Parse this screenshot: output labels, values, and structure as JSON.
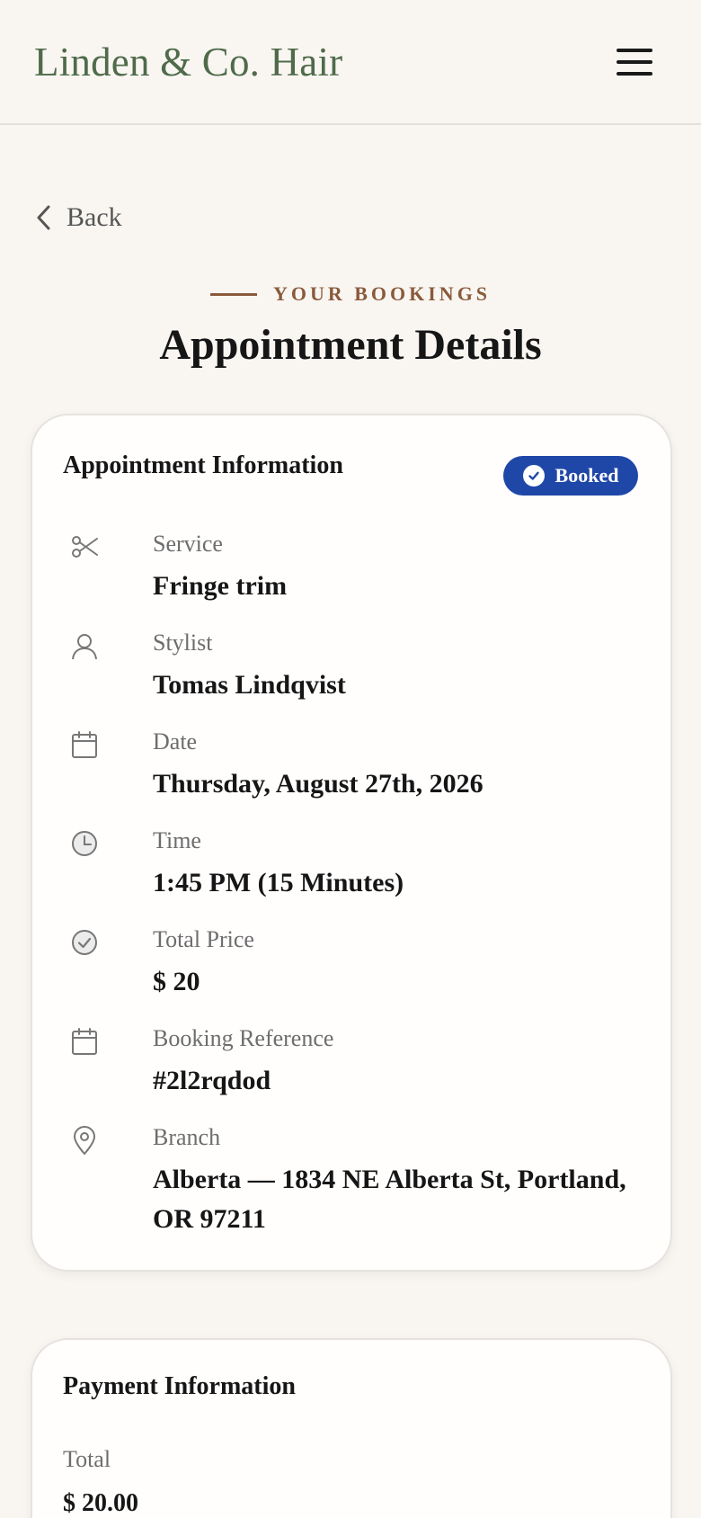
{
  "header": {
    "brand": "Linden & Co. Hair",
    "menu_icon": "hamburger-menu-icon"
  },
  "nav": {
    "back_label": "Back",
    "back_icon": "chevron-left-icon"
  },
  "page": {
    "eyebrow": "YOUR BOOKINGS",
    "title": "Appointment Details"
  },
  "appointment": {
    "title": "Appointment Information",
    "status": "Booked",
    "status_color": "#1f47a8",
    "fields": [
      {
        "icon": "scissors-icon",
        "label": "Service",
        "value": "Fringe trim"
      },
      {
        "icon": "user-icon",
        "label": "Stylist",
        "value": "Tomas Lindqvist"
      },
      {
        "icon": "calendar-icon",
        "label": "Date",
        "value": "Thursday, August 27th, 2026"
      },
      {
        "icon": "clock-icon",
        "label": "Time",
        "value": "1:45 PM (15 Minutes)"
      },
      {
        "icon": "check-circle-icon",
        "label": "Total Price",
        "value": "$ 20"
      },
      {
        "icon": "calendar-icon",
        "label": "Booking Reference",
        "value": "#2l2rqdod"
      },
      {
        "icon": "map-pin-icon",
        "label": "Branch",
        "value": "Alberta — 1834 NE Alberta St, Portland, OR 97211"
      }
    ]
  },
  "payment": {
    "title": "Payment Information",
    "total_label": "Total",
    "total_value": "$ 20.00"
  },
  "colors": {
    "background": "#f9f6f2",
    "brand": "#4f6b4a",
    "accent": "#8a5a3b"
  }
}
